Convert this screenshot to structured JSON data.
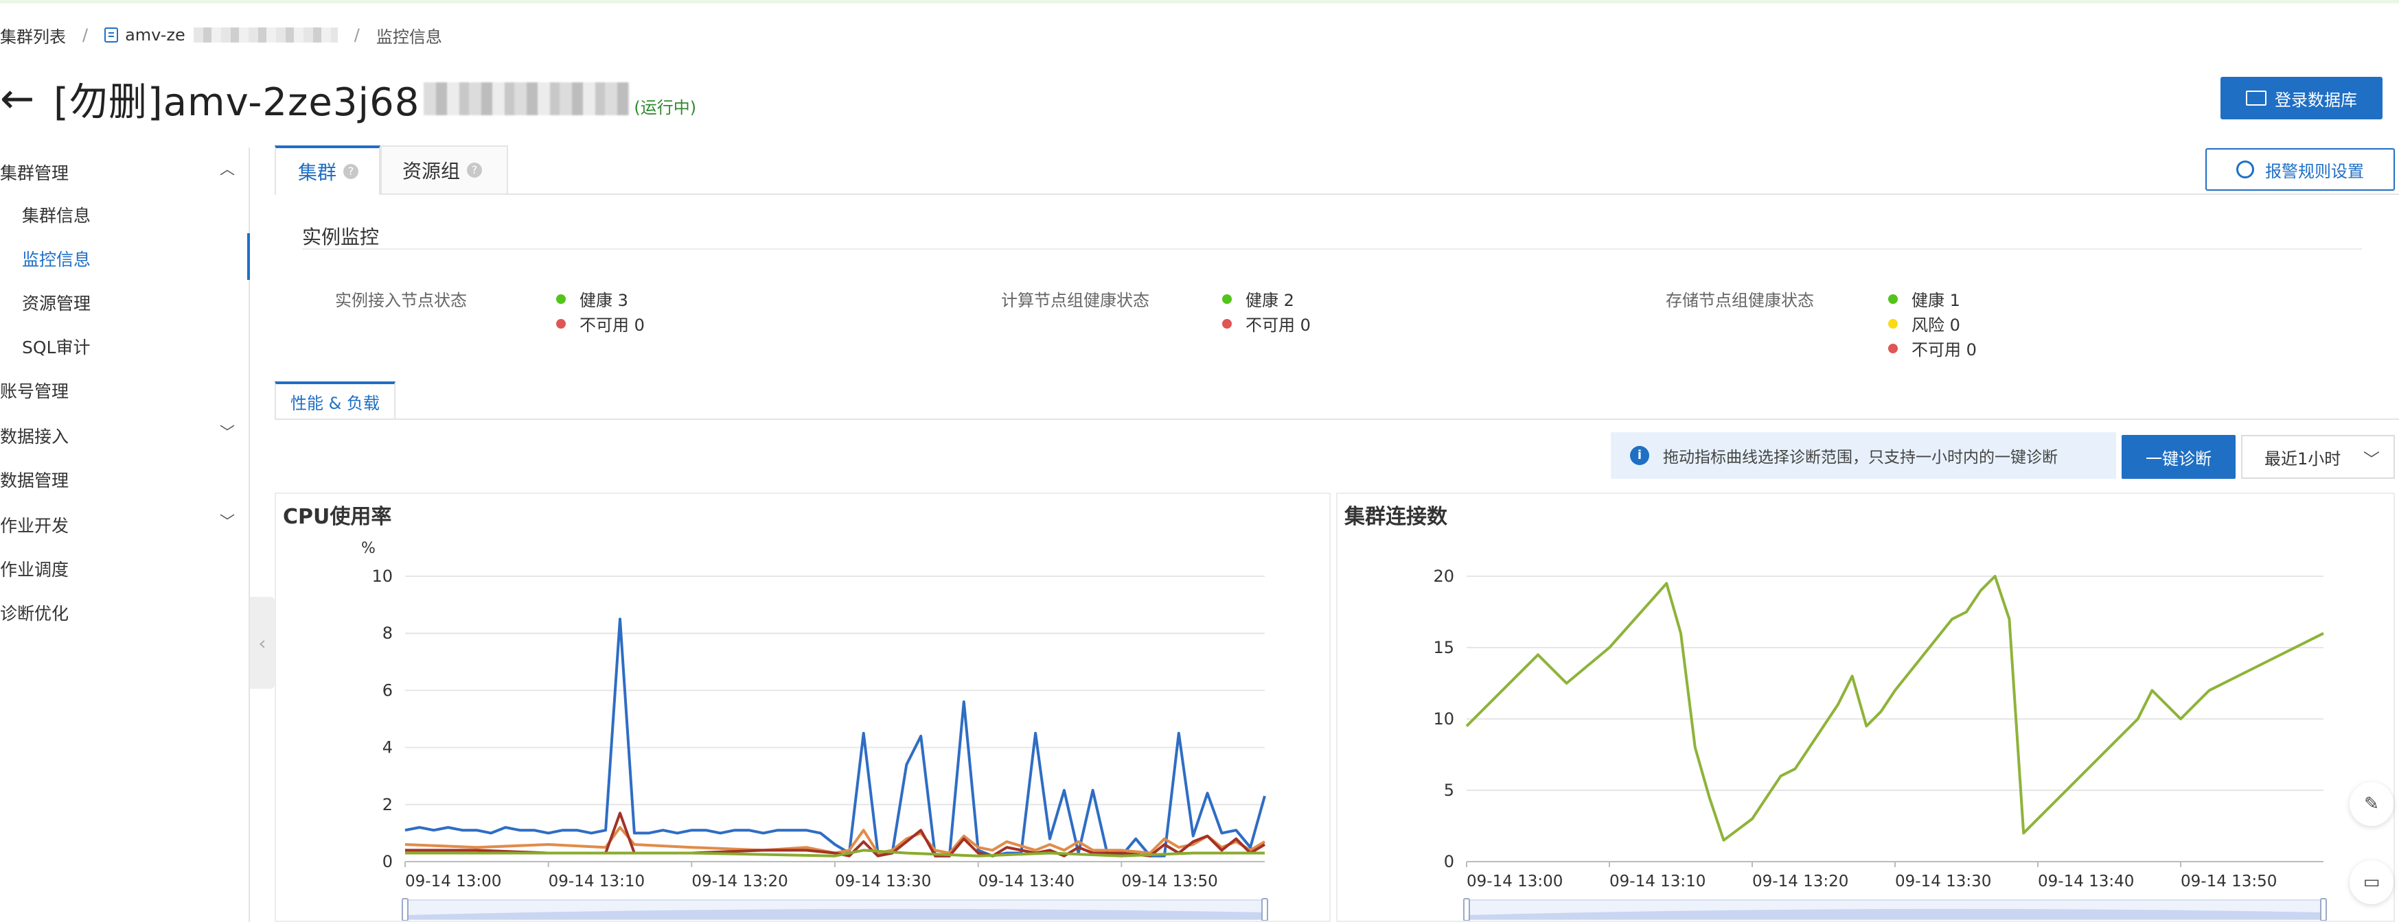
{
  "breadcrumb": {
    "root": "集群列表",
    "cluster": "amv-ze",
    "current": "监控信息"
  },
  "header": {
    "back_glyph": "←",
    "title": "[勿删]amv-2ze3j68",
    "status": "(运行中)",
    "login_button": "登录数据库"
  },
  "sidebar": {
    "cluster_mgmt": "集群管理",
    "items": [
      {
        "label": "集群信息"
      },
      {
        "label": "监控信息"
      },
      {
        "label": "资源管理"
      },
      {
        "label": "SQL审计"
      }
    ],
    "account_mgmt": "账号管理",
    "data_access": "数据接入",
    "data_mgmt": "数据管理",
    "job_dev": "作业开发",
    "job_schedule": "作业调度",
    "diagnosis": "诊断优化"
  },
  "tabs": {
    "cluster": "集群",
    "resource_group": "资源组",
    "help_glyph": "?"
  },
  "alarm_button": "报警规则设置",
  "instance_monitor": {
    "title": "实例监控",
    "access_label": "实例接入节点状态",
    "access_healthy": "健康 3",
    "access_unavailable": "不可用 0",
    "compute_label": "计算节点组健康状态",
    "compute_healthy": "健康 2",
    "compute_unavailable": "不可用 0",
    "storage_label": "存储节点组健康状态",
    "storage_healthy": "健康 1",
    "storage_risk": "风险 0",
    "storage_unavailable": "不可用 0"
  },
  "perf_tab": "性能 & 负载",
  "diagnose": {
    "info": "拖动指标曲线选择诊断范围，只支持一小时内的一键诊断",
    "button": "一键诊断",
    "range": "最近1小时"
  },
  "colors": {
    "accent": "#1f6fc5",
    "healthy": "#52c41a",
    "risk": "#fadb14",
    "unavailable": "#e05555"
  },
  "chart_data": [
    {
      "type": "line",
      "title": "CPU使用率",
      "ylabel": "%",
      "ylim": [
        0,
        10
      ],
      "yticks": [
        0,
        2,
        4,
        6,
        8,
        10
      ],
      "xlim": [
        0,
        60
      ],
      "xticks": [
        {
          "x": 0,
          "label": "09-14 13:00"
        },
        {
          "x": 10,
          "label": "09-14 13:10"
        },
        {
          "x": 20,
          "label": "09-14 13:20"
        },
        {
          "x": 30,
          "label": "09-14 13:30"
        },
        {
          "x": 40,
          "label": "09-14 13:40"
        },
        {
          "x": 50,
          "label": "09-14 13:50"
        }
      ],
      "series": [
        {
          "color": "#2e6dc4",
          "x": [
            0,
            1,
            2,
            3,
            4,
            5,
            6,
            7,
            8,
            9,
            10,
            11,
            12,
            13,
            14,
            15,
            16,
            17,
            18,
            19,
            20,
            21,
            22,
            23,
            24,
            25,
            26,
            27,
            28,
            29,
            30,
            31,
            32,
            33,
            34,
            35,
            36,
            37,
            38,
            39,
            40,
            41,
            42,
            43,
            44,
            45,
            46,
            47,
            48,
            49,
            50,
            51,
            52,
            53,
            54,
            55,
            56,
            57,
            58,
            59,
            60
          ],
          "values": [
            1.1,
            1.2,
            1.1,
            1.2,
            1.1,
            1.1,
            1.0,
            1.2,
            1.1,
            1.1,
            1.0,
            1.1,
            1.1,
            1.0,
            1.1,
            8.5,
            1.0,
            1.0,
            1.1,
            1.0,
            1.1,
            1.1,
            1.0,
            1.1,
            1.1,
            1.0,
            1.1,
            1.1,
            1.1,
            1.0,
            0.6,
            0.3,
            4.5,
            0.3,
            0.3,
            3.4,
            4.4,
            0.2,
            0.2,
            5.6,
            0.4,
            0.2,
            0.3,
            0.3,
            4.5,
            0.8,
            2.5,
            0.3,
            2.5,
            0.3,
            0.2,
            0.8,
            0.2,
            0.2,
            4.5,
            0.9,
            2.4,
            1.0,
            1.1,
            0.5,
            2.3
          ]
        },
        {
          "color": "#e08c4a",
          "x": [
            0,
            5,
            10,
            14,
            15,
            16,
            20,
            25,
            28,
            30,
            31,
            32,
            33,
            34,
            35,
            36,
            37,
            38,
            39,
            40,
            41,
            42,
            44,
            45,
            46,
            47,
            48,
            50,
            52,
            53,
            54,
            55,
            56,
            57,
            58,
            59,
            60
          ],
          "values": [
            0.6,
            0.5,
            0.6,
            0.5,
            1.2,
            0.6,
            0.5,
            0.4,
            0.5,
            0.3,
            0.4,
            1.1,
            0.3,
            0.4,
            0.8,
            1.0,
            0.4,
            0.3,
            0.9,
            0.5,
            0.4,
            0.7,
            0.4,
            0.6,
            0.4,
            0.7,
            0.4,
            0.4,
            0.3,
            0.8,
            0.5,
            0.6,
            0.9,
            0.5,
            0.7,
            0.4,
            0.7
          ]
        },
        {
          "color": "#a33226",
          "x": [
            0,
            5,
            10,
            14,
            15,
            16,
            20,
            25,
            28,
            30,
            31,
            32,
            33,
            34,
            35,
            36,
            37,
            38,
            39,
            40,
            41,
            42,
            44,
            45,
            46,
            47,
            48,
            50,
            52,
            53,
            54,
            55,
            56,
            57,
            58,
            59,
            60
          ],
          "values": [
            0.4,
            0.4,
            0.3,
            0.3,
            1.7,
            0.3,
            0.3,
            0.4,
            0.4,
            0.3,
            0.2,
            0.7,
            0.2,
            0.3,
            0.7,
            1.1,
            0.2,
            0.2,
            0.8,
            0.3,
            0.2,
            0.5,
            0.3,
            0.4,
            0.2,
            0.5,
            0.3,
            0.3,
            0.2,
            0.6,
            0.3,
            0.7,
            0.9,
            0.4,
            0.8,
            0.3,
            0.6
          ]
        },
        {
          "color": "#8aab2e",
          "x": [
            0,
            10,
            20,
            30,
            32,
            35,
            40,
            45,
            50,
            55,
            60
          ],
          "values": [
            0.3,
            0.3,
            0.3,
            0.2,
            0.4,
            0.3,
            0.2,
            0.3,
            0.2,
            0.3,
            0.3
          ]
        }
      ]
    },
    {
      "type": "line",
      "title": "集群连接数",
      "ylim": [
        0,
        20
      ],
      "yticks": [
        0,
        5,
        10,
        15,
        20
      ],
      "xlim": [
        0,
        60
      ],
      "xticks": [
        {
          "x": 0,
          "label": "09-14 13:00"
        },
        {
          "x": 10,
          "label": "09-14 13:10"
        },
        {
          "x": 20,
          "label": "09-14 13:20"
        },
        {
          "x": 30,
          "label": "09-14 13:30"
        },
        {
          "x": 40,
          "label": "09-14 13:40"
        },
        {
          "x": 50,
          "label": "09-14 13:50"
        }
      ],
      "series": [
        {
          "color": "#8eb33a",
          "x": [
            0,
            2,
            5,
            7,
            10,
            14,
            15,
            16,
            17,
            18,
            20,
            21,
            22,
            23,
            24,
            25,
            26,
            27,
            28,
            29,
            30,
            32,
            34,
            35,
            36,
            37,
            38,
            39,
            40,
            45,
            47,
            48,
            50,
            52,
            60
          ],
          "values": [
            9.5,
            11.5,
            14.5,
            12.5,
            15,
            19.5,
            16,
            8,
            4.5,
            1.5,
            3,
            4.5,
            6,
            6.5,
            8,
            9.5,
            11,
            13,
            9.5,
            10.5,
            12,
            14.5,
            17,
            17.5,
            19,
            20,
            17,
            2,
            3,
            8,
            10,
            12,
            10,
            12,
            16
          ]
        }
      ]
    }
  ]
}
